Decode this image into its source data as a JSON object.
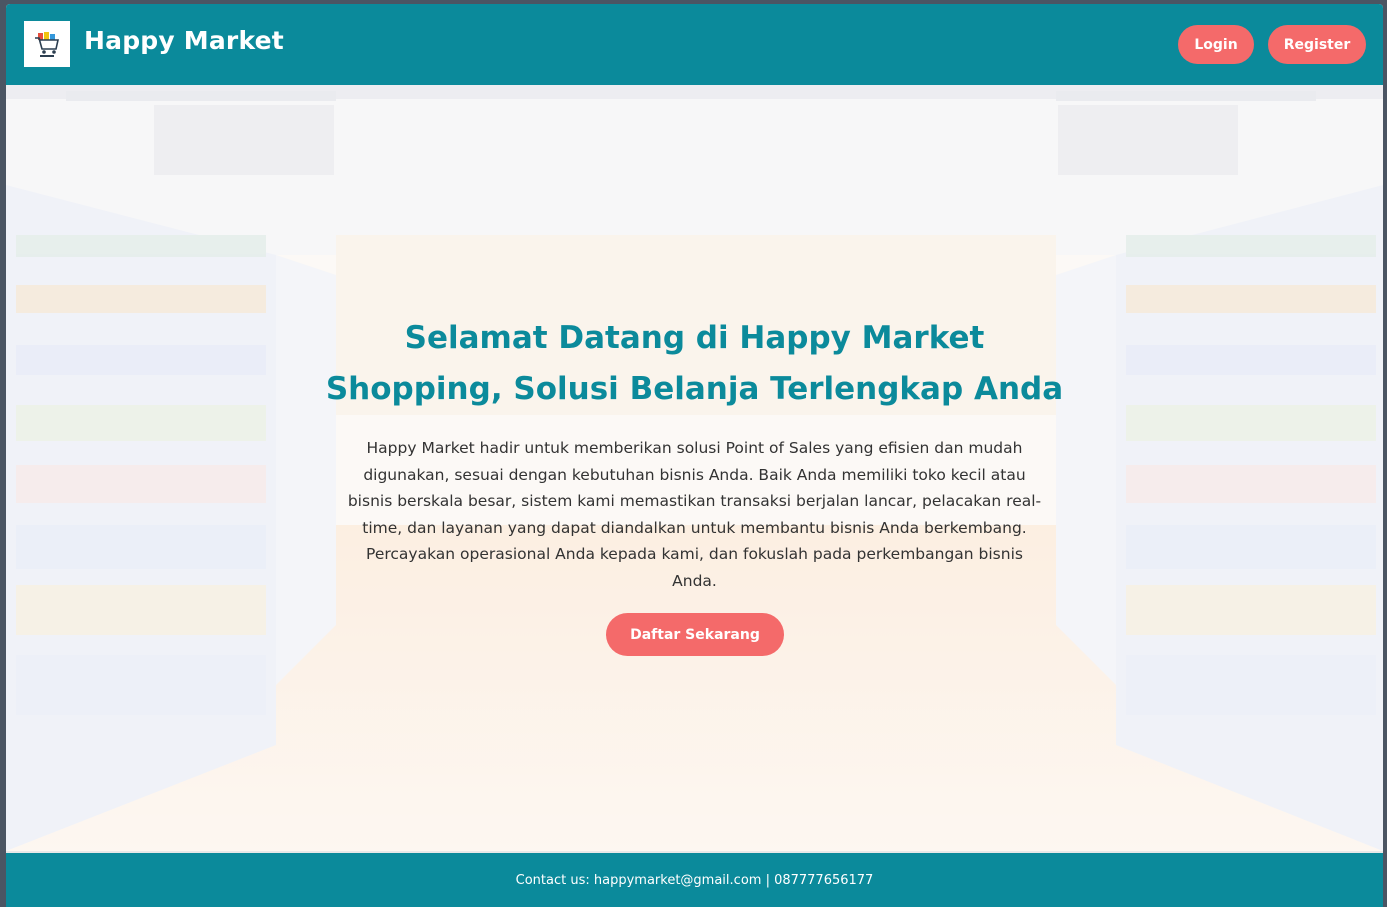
{
  "header": {
    "brand": "Happy Market",
    "logo_icon": "shopping-cart-logo",
    "login_label": "Login",
    "register_label": "Register"
  },
  "hero": {
    "title": "Selamat Datang di Happy Market Shopping, Solusi Belanja Terlengkap Anda",
    "description": "Happy Market hadir untuk memberikan solusi Point of Sales yang efisien dan mudah digunakan, sesuai dengan kebutuhan bisnis Anda. Baik Anda memiliki toko kecil atau bisnis berskala besar, sistem kami memastikan transaksi berjalan lancar, pelacakan real-time, dan layanan yang dapat diandalkan untuk membantu bisnis Anda berkembang. Percayakan operasional Anda kepada kami, dan fokuslah pada perkembangan bisnis Anda.",
    "cta_label": "Daftar Sekarang",
    "background": "supermarket-aisle-image"
  },
  "footer": {
    "contact": "Contact us: happymarket@gmail.com | 087777656177"
  },
  "colors": {
    "primary": "#0b8a9b",
    "accent": "#f46a6a",
    "text": "#333333",
    "frame": "#4b5563"
  }
}
